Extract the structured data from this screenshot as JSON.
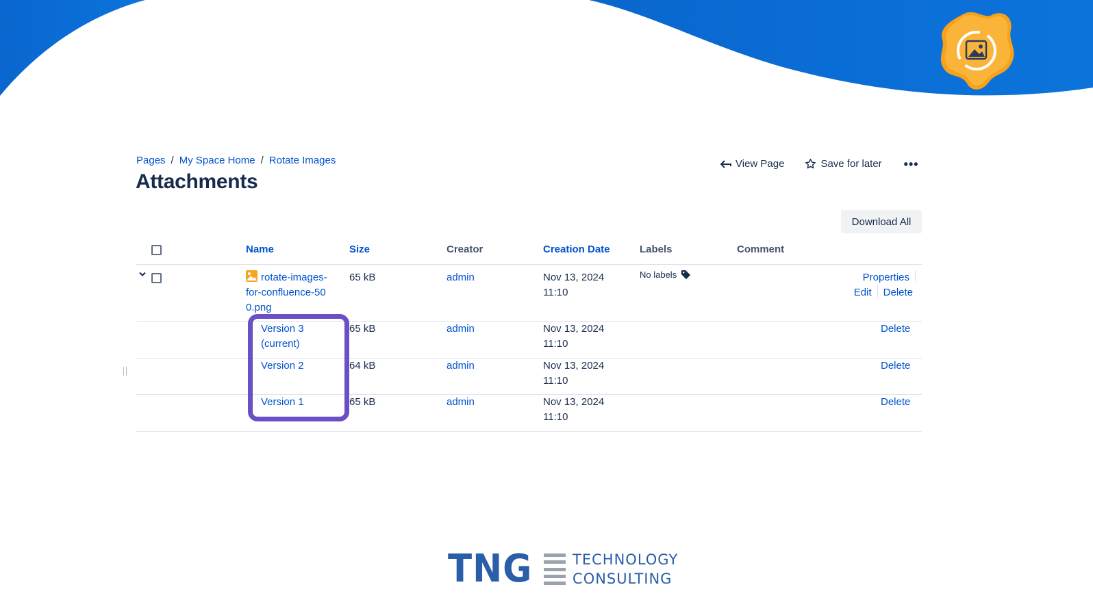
{
  "breadcrumb": {
    "items": [
      "Pages",
      "My Space Home",
      "Rotate Images"
    ],
    "separator": "/"
  },
  "page": {
    "title": "Attachments"
  },
  "actions": {
    "view_page": "View Page",
    "save_for_later": "Save for later",
    "more": "•••"
  },
  "toolbar": {
    "download_all": "Download All"
  },
  "table": {
    "headers": {
      "name": "Name",
      "size": "Size",
      "creator": "Creator",
      "creation_date": "Creation Date",
      "labels": "Labels",
      "comment": "Comment"
    },
    "file": {
      "name": "rotate-images-for-confluence-500.png",
      "size": "65 kB",
      "creator": "admin",
      "date": "Nov 13, 2024",
      "time": "11:10",
      "labels": "No labels",
      "ops": {
        "properties": "Properties",
        "edit": "Edit",
        "delete": "Delete"
      }
    },
    "versions": [
      {
        "name": "Version 3 (current)",
        "size": "65 kB",
        "creator": "admin",
        "date": "Nov 13, 2024",
        "time": "11:10",
        "delete": "Delete"
      },
      {
        "name": "Version 2",
        "size": "64 kB",
        "creator": "admin",
        "date": "Nov 13, 2024",
        "time": "11:10",
        "delete": "Delete"
      },
      {
        "name": "Version 1",
        "size": "65 kB",
        "creator": "admin",
        "date": "Nov 13, 2024",
        "time": "11:10",
        "delete": "Delete"
      }
    ]
  },
  "branding": {
    "logo_short": "TNG",
    "line1": "TECHNOLOGY",
    "line2": "CONSULTING"
  },
  "colors": {
    "wave_blue": "#0b6fd6",
    "link": "#0052cc",
    "highlight": "#6a4fc6",
    "brand_blue": "#2a5ea8",
    "app_icon_orange": "#f7a21b"
  }
}
